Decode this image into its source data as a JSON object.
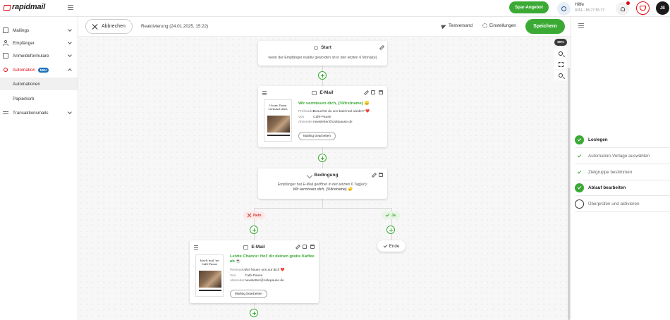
{
  "brand": {
    "name": "rapidmail",
    "accent": "#e30613",
    "green": "#3aaa35"
  },
  "header": {
    "spar_button": "Spar-Angebot",
    "help_label": "Hilfe",
    "help_phone": "0761 - 55 77 55 77",
    "avatar_initials": "JE"
  },
  "sidebar": {
    "items": [
      {
        "label": "Mailings",
        "icon": "mail-icon"
      },
      {
        "label": "Empfänger",
        "icon": "user-icon"
      },
      {
        "label": "Anmeldeformulare",
        "icon": "form-icon"
      },
      {
        "label": "Automation",
        "icon": "automation-icon",
        "badge": "NEU"
      },
      {
        "label": "Transaktionsmails",
        "icon": "transaction-icon"
      }
    ],
    "sub_items": [
      "Automationen",
      "Papierkorb"
    ]
  },
  "toolbar": {
    "cancel_label": "Abbrechen",
    "automation_title": "Reaktivierung (24.01.2025, 15:22)",
    "testsend_label": "Testversand",
    "settings_label": "Einstellungen",
    "save_label": "Speichern"
  },
  "canvas": {
    "zoom_label": "90%",
    "start": {
      "title": "Start",
      "description": "wenn der Empfänger inaktiv geworden ist in den letzten 6 Monat(e)"
    },
    "email1": {
      "title": "E-Mail",
      "thumb_title": "Unser Team vermisst dich",
      "subject": "Wir vermissen dich, {%firstname} 😞",
      "preheader_key": "Preheader",
      "preheader": "Besuchst du uns bald mal wieder? ❤️",
      "from_key": "Von",
      "from": "Café-Pause",
      "sender_key": "Absender",
      "sender": "newsletter@cafepause.de",
      "edit_button": "Mailing bearbeiten"
    },
    "condition": {
      "title": "Bedingung",
      "line1": "Empfänger hat E-Mail geöffnet in den letzten 6 Tag(en):",
      "line2": "Wir vermissen dich, {%firstname} 😞"
    },
    "branch_no": "Nein",
    "branch_yes": "Ja",
    "end_label": "Ende",
    "email2": {
      "title": "E-Mail",
      "thumb_title": "Mach mal 'ne Café-Pause",
      "subject": "Letzte Chance: Hol' dir deinen gratis Kaffee ab ☕",
      "preheader_key": "Preheader",
      "preheader": "Wir freuen uns auf dich ❤️",
      "from_key": "Von",
      "from": "Café-Pause",
      "sender_key": "Absender",
      "sender": "newsletter@cafepause.de",
      "edit_button": "Mailing bearbeiten"
    }
  },
  "steps": [
    {
      "label": "Loslegen",
      "state": "done"
    },
    {
      "label": "Automation-Vorlage auswählen",
      "state": "sub"
    },
    {
      "label": "Zielgruppe bestimmen",
      "state": "sub"
    },
    {
      "label": "Ablauf bearbeiten",
      "state": "done"
    },
    {
      "label": "Überprüfen und aktivieren",
      "state": "open"
    }
  ]
}
